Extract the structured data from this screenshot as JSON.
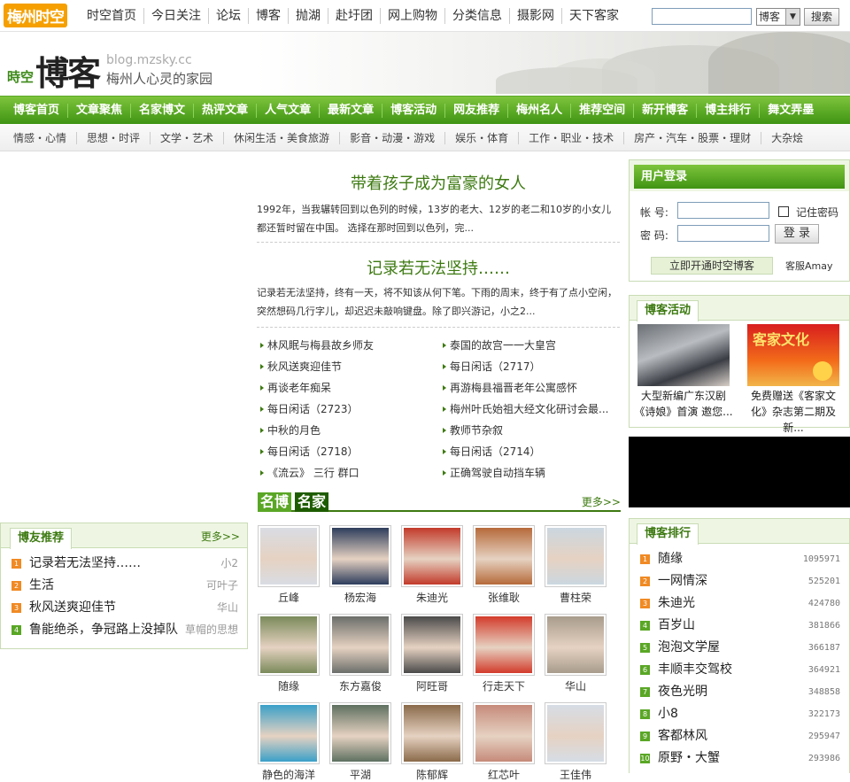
{
  "top": {
    "logo": "梅州时空",
    "nav": [
      "时空首页",
      "今日关注",
      "论坛",
      "博客",
      "抛湖",
      "赴圩团",
      "网上购物",
      "分类信息",
      "摄影网",
      "天下客家"
    ],
    "search_value": "",
    "search_select": "博客",
    "search_button": "搜索"
  },
  "banner": {
    "brand_small": "時空",
    "brand_big": "博客",
    "url": "blog.mzsky.cc",
    "slogan": "梅州人心灵的家园"
  },
  "mainnav": [
    "博客首页",
    "文章聚焦",
    "名家博文",
    "热评文章",
    "人气文章",
    "最新文章",
    "博客活动",
    "网友推荐",
    "梅州名人",
    "推荐空间",
    "新开博客",
    "博主排行",
    "舞文弄墨"
  ],
  "subnav": [
    "情感・心情",
    "思想・时评",
    "文学・艺术",
    "休闲生活・美食旅游",
    "影音・动漫・游戏",
    "娱乐・体育",
    "工作・职业・技术",
    "房产・汽车・股票・理财",
    "大杂烩"
  ],
  "featured": [
    {
      "title": "带着孩子成为富豪的女人",
      "body": "1992年，当我辗转回到以色列的时候，13岁的老大、12岁的老二和10岁的小女儿都还暂时留在中国。 选择在那时回到以色列，完..."
    },
    {
      "title": "记录若无法坚持……",
      "body": "记录若无法坚持，终有一天，将不知该从何下笔。下雨的周末，终于有了点小空闲，突然想码几行字儿，却迟迟未敲响键盘。除了即兴游记，小之2..."
    }
  ],
  "articles": [
    "林风眠与梅县故乡师友",
    "泰国的故宫一一大皇宫",
    "秋风送爽迎佳节",
    "每日闲话（2717）",
    "再谈老年痴呆",
    "再游梅县福晋老年公寓感怀",
    "每日闲话（2723）",
    "梅州叶氏始祖大经文化研讨会最...",
    "中秋的月色",
    "教师节杂叙",
    "每日闲话（2718）",
    "每日闲话（2714）",
    "《流云》 三行 群口",
    "正确驾驶自动挡车辆"
  ],
  "mingbo": {
    "t1": "名博",
    "t2": "名家",
    "more": "更多>>",
    "people": [
      "丘峰",
      "杨宏海",
      "朱迪光",
      "张维耿",
      "曹柱荣",
      "随缘",
      "东方嘉俊",
      "阿旺哥",
      "行走天下",
      "华山",
      "静色的海洋",
      "平湖",
      "陈郁辉",
      "红芯叶",
      "王佳伟"
    ]
  },
  "bt": {
    "tab": "博友推荐",
    "more": "更多>>",
    "items": [
      {
        "n": "1",
        "t": "记录若无法坚持……",
        "r": "小2"
      },
      {
        "n": "2",
        "t": "生活",
        "r": "可叶子"
      },
      {
        "n": "3",
        "t": "秋风送爽迎佳节",
        "r": "华山"
      },
      {
        "n": "4",
        "t": "鲁能绝杀，争冠路上没掉队",
        "r": "草帽的思想"
      }
    ]
  },
  "login": {
    "head": "用户登录",
    "account": "帐 号:",
    "password": "密 码:",
    "remember": "记住密码",
    "button": "登 录",
    "open": "立即开通时空博客",
    "service": "客服Amay"
  },
  "activity": {
    "tab": "博客活动",
    "items": [
      {
        "cap": "大型新编广东汉剧《诗娘》首演 邀您..."
      },
      {
        "cap": "免费赠送《客家文化》杂志第二期及新...",
        "img_text": "客家文化"
      }
    ]
  },
  "rank": {
    "tab": "博客排行",
    "items": [
      {
        "n": "1",
        "t": "随缘",
        "r": "1095971"
      },
      {
        "n": "2",
        "t": "一网情深",
        "r": "525201"
      },
      {
        "n": "3",
        "t": "朱迪光",
        "r": "424780"
      },
      {
        "n": "4",
        "t": "百岁山",
        "r": "381866"
      },
      {
        "n": "5",
        "t": "泡泡文学屋",
        "r": "366187"
      },
      {
        "n": "6",
        "t": "丰顺丰交驾校",
        "r": "364921"
      },
      {
        "n": "7",
        "t": "夜色光明",
        "r": "348858"
      },
      {
        "n": "8",
        "t": "小8",
        "r": "322173"
      },
      {
        "n": "9",
        "t": "客都林风",
        "r": "295947"
      },
      {
        "n": "10",
        "t": "原野・大蟹",
        "r": "293986"
      }
    ]
  },
  "colors": {
    "accent": "#3f9413",
    "accent_light": "#7ec43c",
    "orange": "#f08a24"
  }
}
